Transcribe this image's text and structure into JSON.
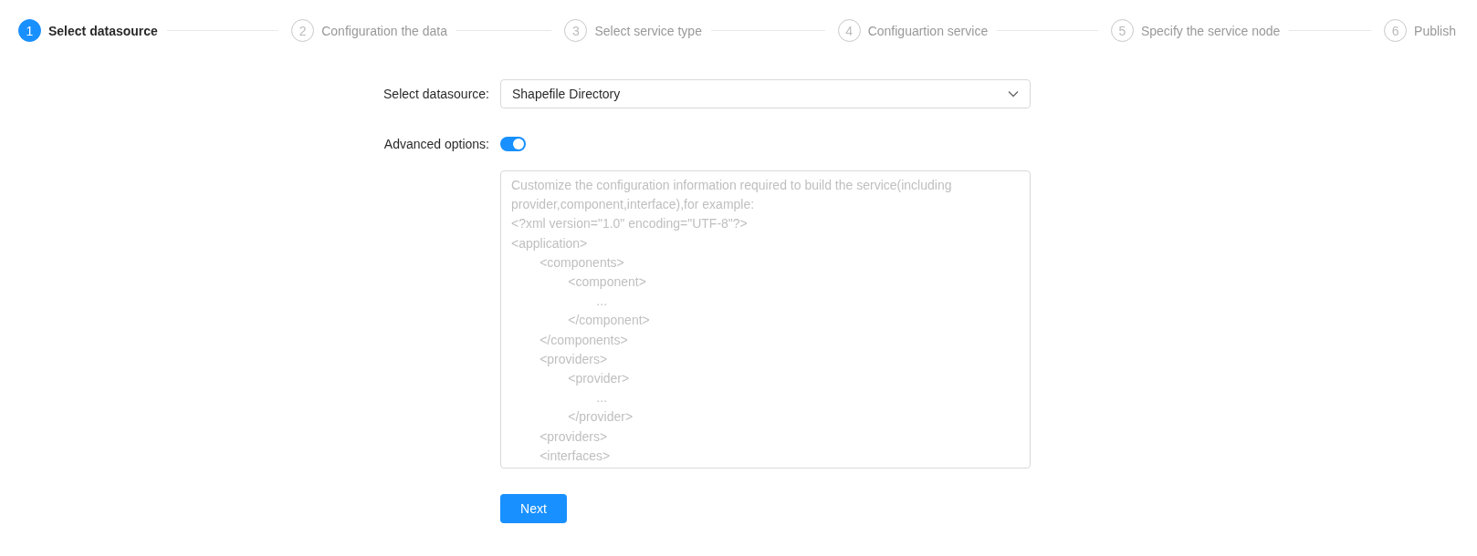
{
  "steps": [
    {
      "number": "1",
      "label": "Select datasource",
      "selected": true
    },
    {
      "number": "2",
      "label": "Configuration the data",
      "selected": false
    },
    {
      "number": "3",
      "label": "Select service type",
      "selected": false
    },
    {
      "number": "4",
      "label": "Configuartion service",
      "selected": false
    },
    {
      "number": "5",
      "label": "Specify the service node",
      "selected": false
    },
    {
      "number": "6",
      "label": "Publish",
      "selected": false
    }
  ],
  "form": {
    "datasource": {
      "label": "Select datasource:",
      "value": "Shapefile Directory"
    },
    "advanced": {
      "label": "Advanced options:",
      "on": true
    },
    "config": {
      "placeholder": "Customize the configuration information required to build the service(including provider,component,interface),for example:\n<?xml version=\"1.0\" encoding=\"UTF-8\"?>\n<application>\n        <components>\n                <component>\n                        ...\n                </component>\n        </components>\n        <providers>\n                <provider>\n                        ...\n                </provider>\n        <providers>\n        <interfaces>"
    }
  },
  "next_button": "Next"
}
